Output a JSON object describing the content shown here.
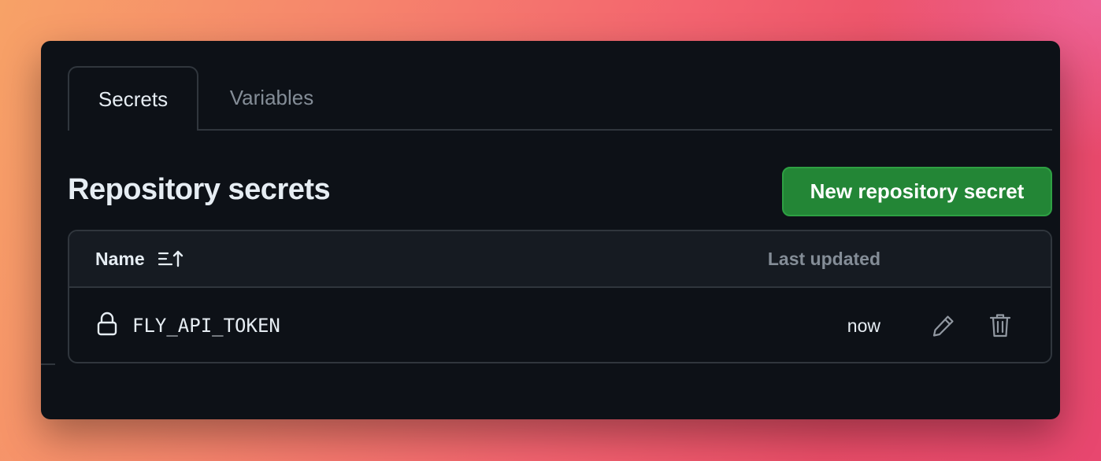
{
  "tabs": [
    {
      "label": "Secrets",
      "active": true
    },
    {
      "label": "Variables",
      "active": false
    }
  ],
  "section": {
    "title": "Repository secrets",
    "new_button_label": "New repository secret"
  },
  "table": {
    "columns": {
      "name": "Name",
      "last_updated": "Last updated"
    },
    "rows": [
      {
        "name": "FLY_API_TOKEN",
        "last_updated": "now"
      }
    ]
  },
  "icons": {
    "sort": "sort-ascending-icon",
    "lock": "lock-icon",
    "edit": "pencil-icon",
    "delete": "trash-icon"
  },
  "colors": {
    "background": "#0d1117",
    "border": "#30363d",
    "header_bg": "#161b22",
    "primary_button": "#238636",
    "text": "#e6edf3",
    "muted_text": "#848d97"
  }
}
